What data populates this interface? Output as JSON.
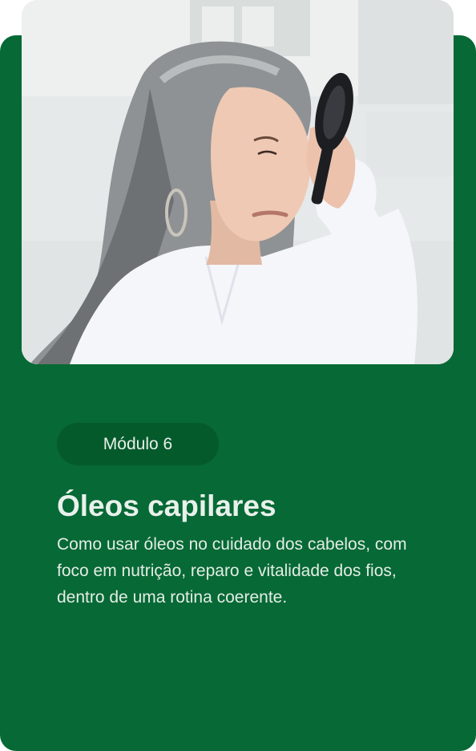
{
  "module_card": {
    "badge_label": "Módulo 6",
    "title": "Óleos capilares",
    "description": "Como usar óleos no cuidado dos cabelos, com foco em nutrição, reparo e vitalidade dos fios, dentro de uma rotina coerente."
  },
  "colors": {
    "card_background": "#076935",
    "badge_background": "#055a2c",
    "text": "#e9f1ec"
  },
  "photo": {
    "subject": "woman with long grey hair brushing her hair",
    "icon": "hairbrush-icon"
  }
}
